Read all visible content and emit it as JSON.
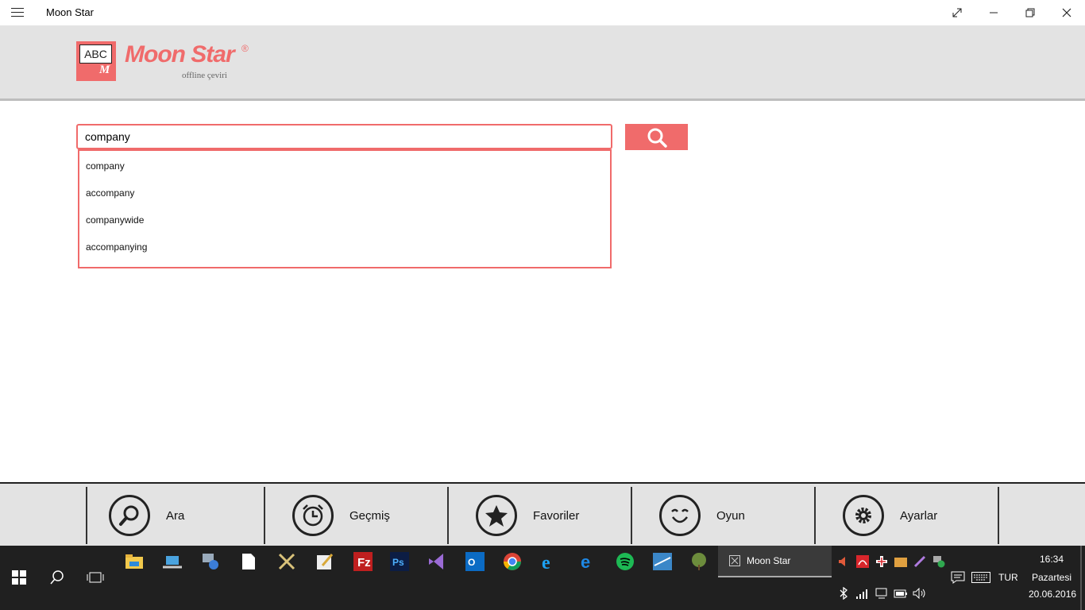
{
  "window": {
    "title": "Moon Star"
  },
  "logo": {
    "box_text": "ABC",
    "box_letter": "M",
    "name": "Moon Star",
    "reg": "®",
    "subtitle": "offline çeviri"
  },
  "search": {
    "value": "company",
    "suggestions": [
      "company",
      "accompany",
      "companywide",
      "accompanying"
    ]
  },
  "nav": [
    {
      "label": "Ara",
      "icon": "search-icon"
    },
    {
      "label": "Geçmiş",
      "icon": "alarm-clock-icon"
    },
    {
      "label": "Favoriler",
      "icon": "star-icon"
    },
    {
      "label": "Oyun",
      "icon": "smiley-icon"
    },
    {
      "label": "Ayarlar",
      "icon": "gear-icon"
    }
  ],
  "taskbar": {
    "active_app": "Moon Star",
    "language": "TUR",
    "time": "16:34",
    "day": "Pazartesi",
    "date": "20.06.2016",
    "pinned": [
      "file-explorer-icon",
      "laptop-icon",
      "network-icon",
      "file-icon",
      "tools-icon",
      "notepad-icon",
      "filezilla-icon",
      "photoshop-icon",
      "visual-studio-icon",
      "outlook-icon",
      "chrome-icon",
      "internet-explorer-icon",
      "edge-icon",
      "spotify-icon",
      "app-icon",
      "tree-icon"
    ]
  },
  "colors": {
    "accent": "#f06b6b",
    "header": "#e3e3e3",
    "taskbar": "#202020"
  }
}
